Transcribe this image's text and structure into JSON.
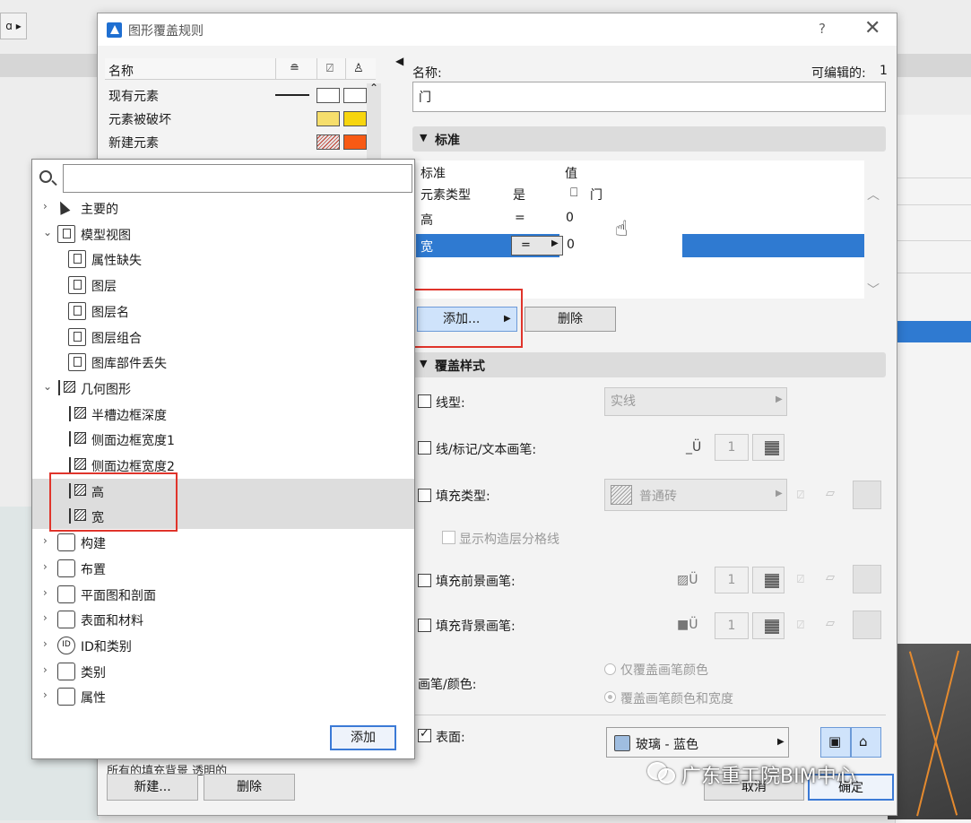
{
  "background": {
    "corner_label": "ɑ ▸"
  },
  "dialog": {
    "title": "图形覆盖规则",
    "help": "?",
    "close": "✕"
  },
  "rule_list": {
    "headers": {
      "name": "名称",
      "col1_icon": "line-icon",
      "col2_icon": "fill-icon",
      "col3_icon": "pen-icon"
    },
    "rows": [
      {
        "name": "现有元素",
        "fill1": "#ffffff",
        "fill2": "#ffffff"
      },
      {
        "name": "元素被破坏",
        "fill1": "#f6de6c",
        "fill2": "#f7d50e"
      },
      {
        "name": "新建元素",
        "fill1": "#f46a3b",
        "fill2": "#f85a14"
      }
    ],
    "bottom_text": "所有的填充背景    透明的",
    "new_button": "新建...",
    "delete_button": "删除"
  },
  "popup": {
    "search_placeholder": "",
    "add_button": "添加",
    "tree": [
      {
        "label": "主要的",
        "icon": "cursor-icon",
        "expand": "›"
      },
      {
        "label": "模型视图",
        "icon": "model-view-icon",
        "expand": "⌄"
      },
      {
        "label": "属性缺失",
        "icon": "model-view-icon"
      },
      {
        "label": "图层",
        "icon": "model-view-icon"
      },
      {
        "label": "图层名",
        "icon": "model-view-icon"
      },
      {
        "label": "图层组合",
        "icon": "model-view-icon"
      },
      {
        "label": "图库部件丢失",
        "icon": "model-view-icon"
      },
      {
        "label": "几何图形",
        "icon": "dimension-icon",
        "expand": "⌄"
      },
      {
        "label": "半槽边框深度",
        "icon": "dimension-icon"
      },
      {
        "label": "侧面边框宽度1",
        "icon": "dimension-icon"
      },
      {
        "label": "侧面边框宽度2",
        "icon": "dimension-icon"
      },
      {
        "label": "高",
        "icon": "dimension-icon"
      },
      {
        "label": "宽",
        "icon": "dimension-icon"
      },
      {
        "label": "构建",
        "icon": "construction-icon",
        "expand": "›"
      },
      {
        "label": "布置",
        "icon": "placement-icon",
        "expand": "›"
      },
      {
        "label": "平面图和剖面",
        "icon": "plan-section-icon",
        "expand": "›"
      },
      {
        "label": "表面和材料",
        "icon": "surface-icon",
        "expand": "›"
      },
      {
        "label": "ID和类别",
        "icon": "id-icon",
        "expand": "›"
      },
      {
        "label": "类别",
        "icon": "classification-icon",
        "expand": "›"
      },
      {
        "label": "属性",
        "icon": "property-icon",
        "expand": "›"
      }
    ]
  },
  "details": {
    "name_label": "名称:",
    "editable_label": "可编辑的:",
    "editable_value": "1",
    "name_value": "门",
    "criteria_section": "标准",
    "criteria_headers": {
      "criterion": "标准",
      "value": "值"
    },
    "criteria_rows": [
      {
        "criterion": "元素类型",
        "operator": "是",
        "value": "门"
      },
      {
        "criterion": "高",
        "operator": "=",
        "value": "0"
      },
      {
        "criterion": "宽",
        "operator": "=",
        "value": "0"
      }
    ],
    "add_button": "添加...",
    "delete_button": "删除",
    "style_section": "覆盖样式",
    "line_type_label": "线型:",
    "line_type_value": "实线",
    "line_pen_label": "线/标记/文本画笔:",
    "line_pen_value": "1",
    "fill_type_label": "填充类型:",
    "fill_type_value": "普通砖",
    "show_skin_lines_label": "显示构造层分格线",
    "fill_fg_pen_label": "填充前景画笔:",
    "fill_fg_pen_value": "1",
    "fill_bg_pen_label": "填充背景画笔:",
    "fill_bg_pen_value": "1",
    "pen_color_label": "画笔/颜色:",
    "radio_color_only": "仅覆盖画笔颜色",
    "radio_color_weight": "覆盖画笔颜色和宽度",
    "surface_label": "表面:",
    "surface_value": "玻璃 - 蓝色",
    "cancel_button": "取消",
    "ok_button": "确定"
  },
  "watermark": "广东重工院BIM中心",
  "colors": {
    "selection": "#2f7ad1",
    "annotation": "#e0342b"
  }
}
